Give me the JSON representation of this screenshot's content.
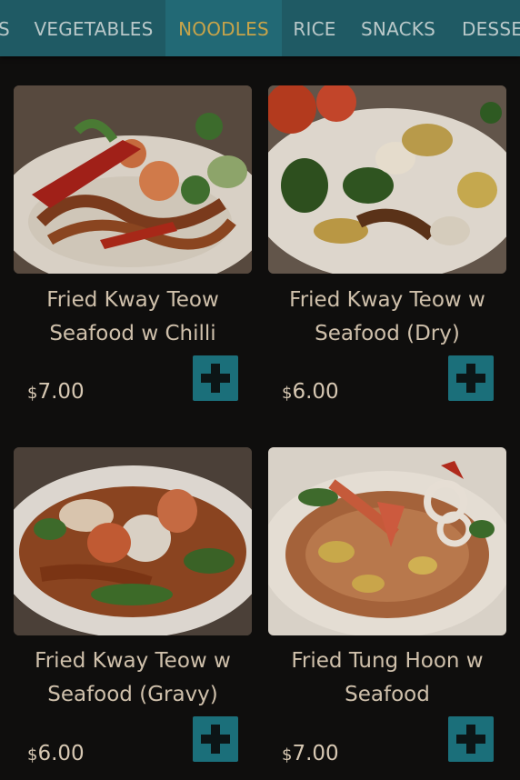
{
  "categories": [
    {
      "label": "S",
      "active": false
    },
    {
      "label": "VEGETABLES",
      "active": false
    },
    {
      "label": "NOODLES",
      "active": true
    },
    {
      "label": "RICE",
      "active": false
    },
    {
      "label": "SNACKS",
      "active": false
    },
    {
      "label": "DESSE",
      "active": false
    }
  ],
  "items": [
    {
      "name_line1": "Fried Kway Teow",
      "name_line2": "Seafood w Chilli",
      "currency": "$",
      "price": "7.00",
      "add_icon": "plus-icon"
    },
    {
      "name_line1": "Fried Kway Teow w",
      "name_line2": "Seafood (Dry)",
      "currency": "$",
      "price": "6.00",
      "add_icon": "plus-icon"
    },
    {
      "name_line1": "Fried Kway Teow w",
      "name_line2": "Seafood (Gravy)",
      "currency": "$",
      "price": "6.00",
      "add_icon": "plus-icon"
    },
    {
      "name_line1": "Fried Tung Hoon w",
      "name_line2": "Seafood",
      "currency": "$",
      "price": "7.00",
      "add_icon": "plus-icon"
    }
  ],
  "colors": {
    "category_bar": "#1f5a64",
    "active_category_text": "#c7a44a",
    "add_button": "#1b6f7a"
  }
}
